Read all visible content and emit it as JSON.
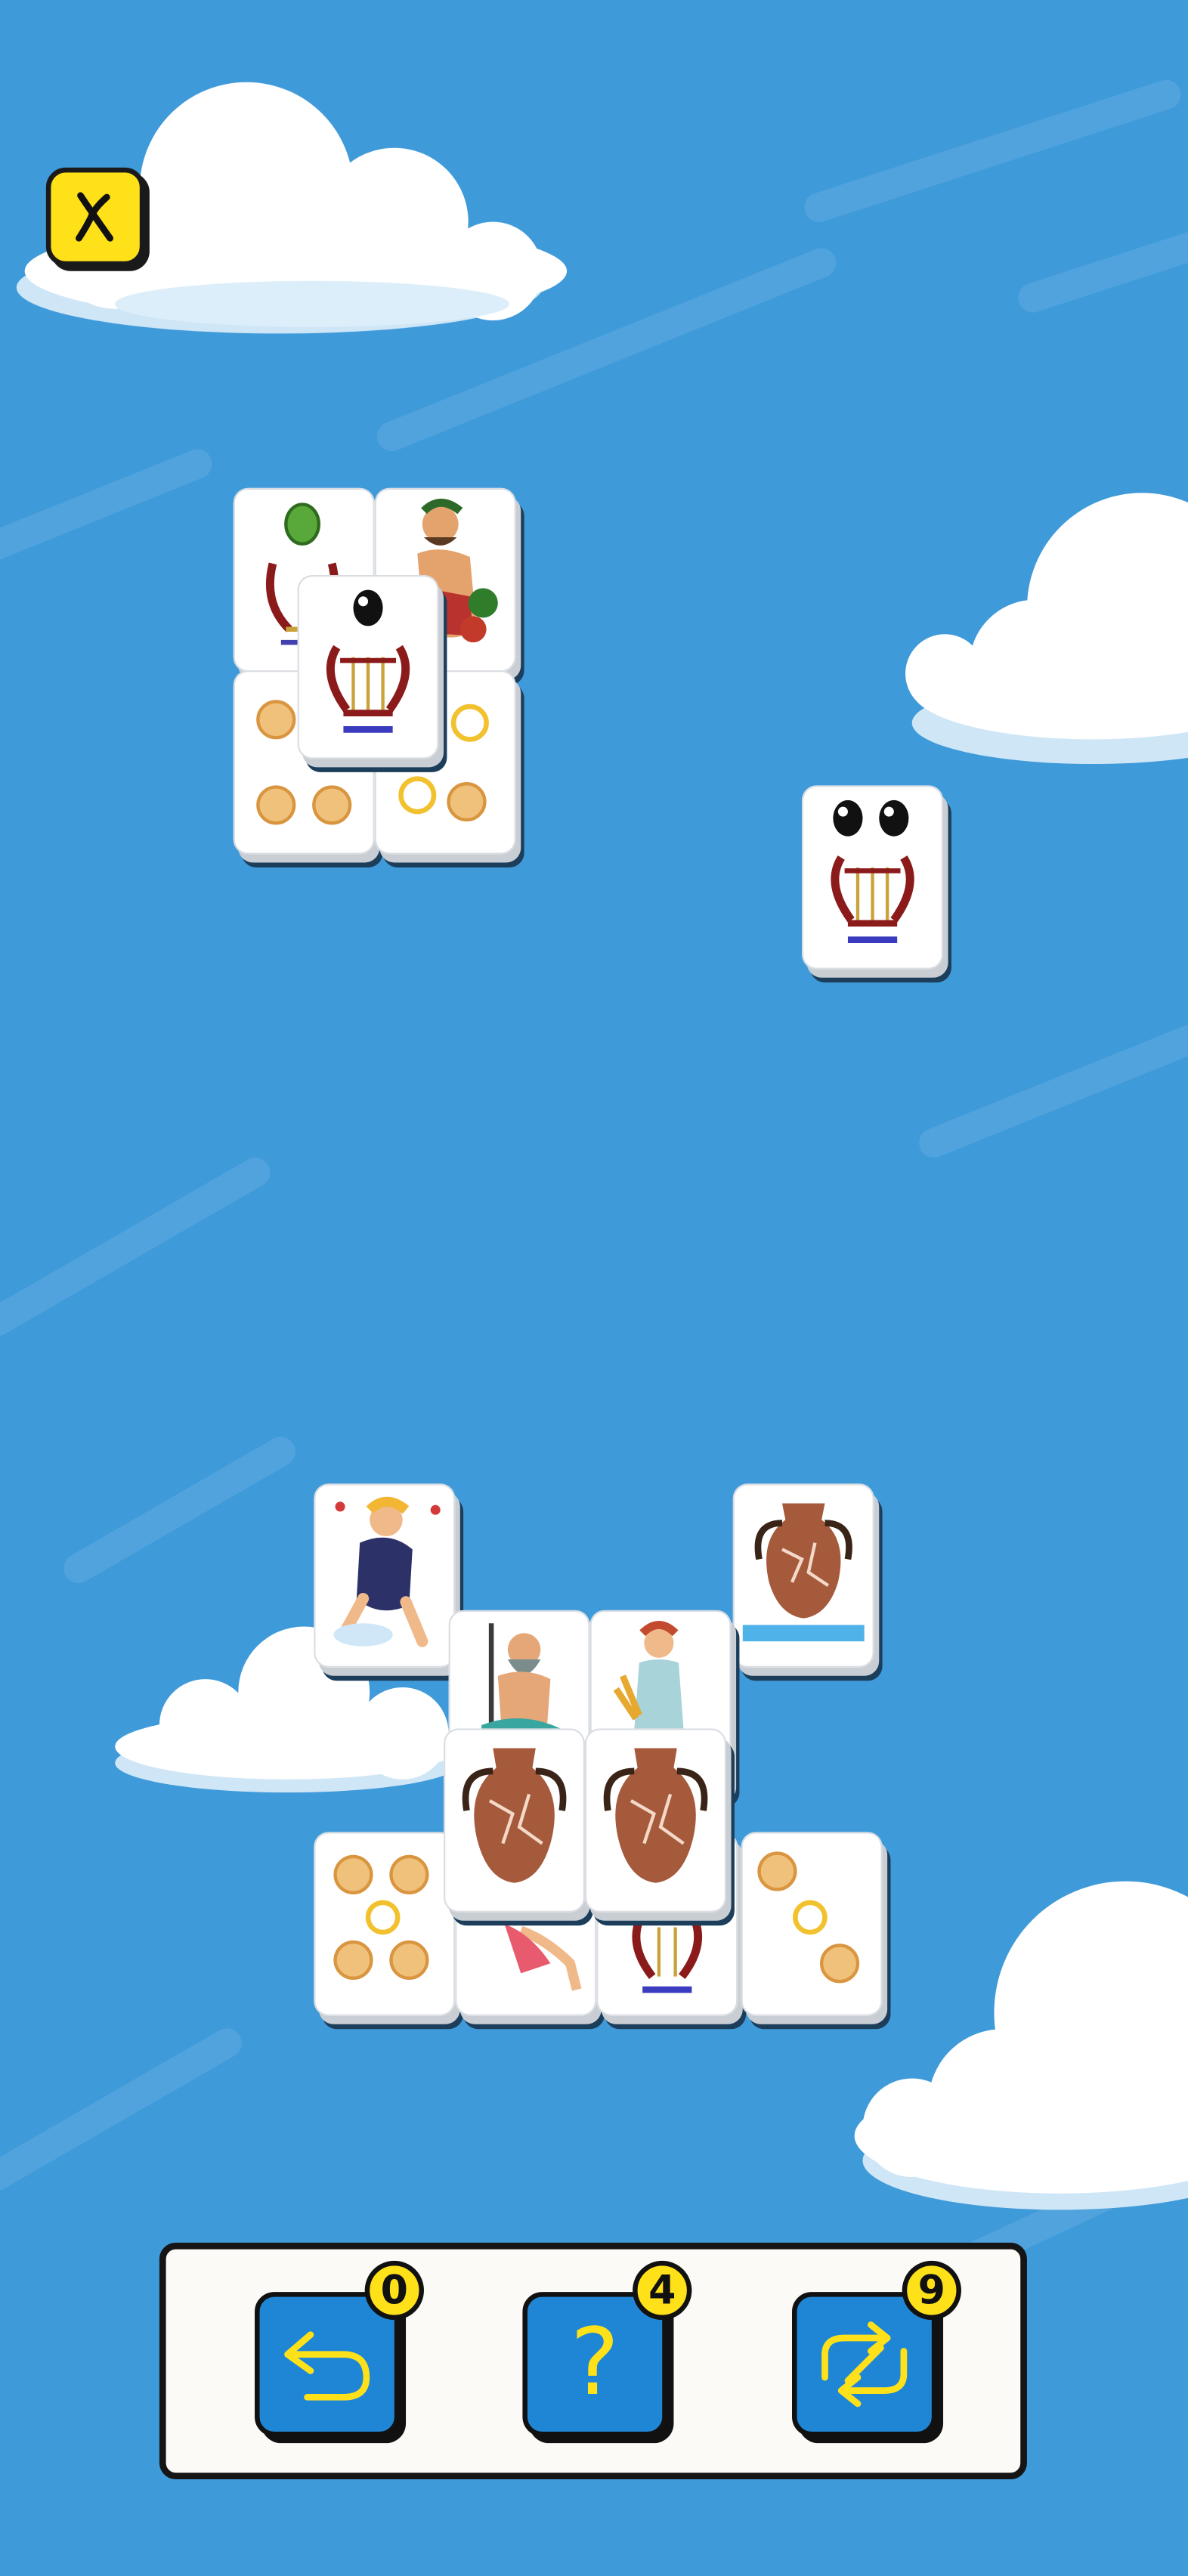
{
  "colors": {
    "sky": "#3f9ad9",
    "button_blue": "#1f86d6",
    "accent_yellow": "#ffe11a"
  },
  "top_bar": {
    "close_icon": "close-icon"
  },
  "board": {
    "tiles": [
      {
        "id": "t1",
        "face": "lyre",
        "pips": 1,
        "pip_color": "green"
      },
      {
        "id": "t2",
        "face": "god-dionysus"
      },
      {
        "id": "t3",
        "face": "coins",
        "count": 4
      },
      {
        "id": "t4",
        "face": "coins",
        "count": 4
      },
      {
        "id": "t5",
        "face": "lyre",
        "pips": 1,
        "pip_color": "black"
      },
      {
        "id": "t6",
        "face": "lyre",
        "pips": 2,
        "pip_color": "black"
      },
      {
        "id": "t7",
        "face": "god-zodiac"
      },
      {
        "id": "t8",
        "face": "amphora"
      },
      {
        "id": "t9",
        "face": "god-poseidon"
      },
      {
        "id": "t10",
        "face": "goddess-demeter"
      },
      {
        "id": "t11",
        "face": "amphora"
      },
      {
        "id": "t12",
        "face": "amphora"
      },
      {
        "id": "t13",
        "face": "coins",
        "count": 5
      },
      {
        "id": "t14",
        "face": "god-hermes"
      },
      {
        "id": "t15",
        "face": "lyre"
      },
      {
        "id": "t16",
        "face": "coins",
        "count": 3
      }
    ]
  },
  "toolbar": {
    "undo": {
      "icon": "undo-icon",
      "count": "0"
    },
    "hint": {
      "icon": "hint-icon",
      "label": "?",
      "count": "4"
    },
    "shuffle": {
      "icon": "shuffle-icon",
      "count": "9"
    }
  }
}
